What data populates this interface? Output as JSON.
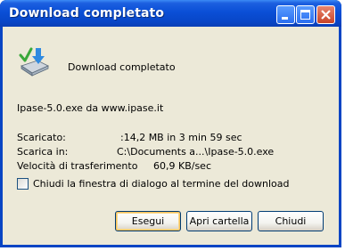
{
  "window": {
    "title": "Download completato"
  },
  "dialog": {
    "heading": "Download completato",
    "file_source": "Ipase-5.0.exe da www.ipase.it",
    "downloaded_label": "Scaricato:",
    "downloaded_value": ":14,2 MB in 3 min 59 sec",
    "save_to_label": "Scarica in:",
    "save_to_value": "C:\\Documents a...\\Ipase-5.0.exe",
    "speed_label": "Velocità di trasferimento",
    "speed_value": "60,9 KB/sec",
    "close_on_complete_label": "Chiudi la finestra di dialogo al termine del download",
    "close_on_complete_checked": false
  },
  "buttons": {
    "run": "Esegui",
    "open_folder": "Apri cartella",
    "close": "Chiudi"
  },
  "icons": {
    "dialog_icon": "download-complete-icon",
    "minimize": "minimize-icon",
    "maximize": "maximize-icon",
    "close": "close-icon"
  },
  "colors": {
    "titlebar": "#0a4fd6",
    "dialog_background": "#ece9d8",
    "close_button": "#c84428",
    "default_button_highlight": "#f5c05a"
  }
}
